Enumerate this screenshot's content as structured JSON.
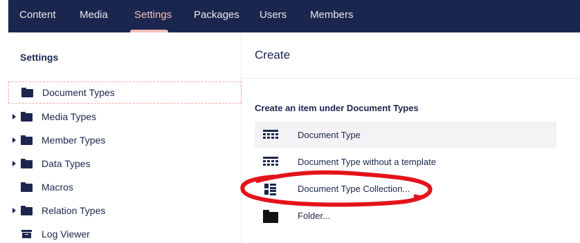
{
  "topnav": {
    "tabs": [
      {
        "label": "Content"
      },
      {
        "label": "Media"
      },
      {
        "label": "Settings",
        "active": true
      },
      {
        "label": "Packages"
      },
      {
        "label": "Users"
      },
      {
        "label": "Members"
      }
    ]
  },
  "tree": {
    "header": "Settings",
    "items": [
      {
        "label": "Document Types",
        "icon": "folder-icon",
        "expandable": false,
        "selected": true
      },
      {
        "label": "Media Types",
        "icon": "folder-icon",
        "expandable": true
      },
      {
        "label": "Member Types",
        "icon": "folder-icon",
        "expandable": true
      },
      {
        "label": "Data Types",
        "icon": "folder-icon",
        "expandable": true
      },
      {
        "label": "Macros",
        "icon": "folder-icon",
        "expandable": false
      },
      {
        "label": "Relation Types",
        "icon": "folder-icon",
        "expandable": true
      },
      {
        "label": "Log Viewer",
        "icon": "archive-icon",
        "expandable": false
      }
    ]
  },
  "create": {
    "title": "Create",
    "subtitle": "Create an item under Document Types",
    "options": [
      {
        "label": "Document Type",
        "icon": "document-type-icon"
      },
      {
        "label": "Document Type without a template",
        "icon": "document-type-icon"
      },
      {
        "label": "Document Type Collection...",
        "icon": "collection-icon"
      },
      {
        "label": "Folder...",
        "icon": "folder-icon"
      }
    ]
  },
  "colors": {
    "nav_bg": "#1b264f",
    "nav_active": "#f5c1bc",
    "text": "#1b264f",
    "annotation": "#e3131b"
  }
}
